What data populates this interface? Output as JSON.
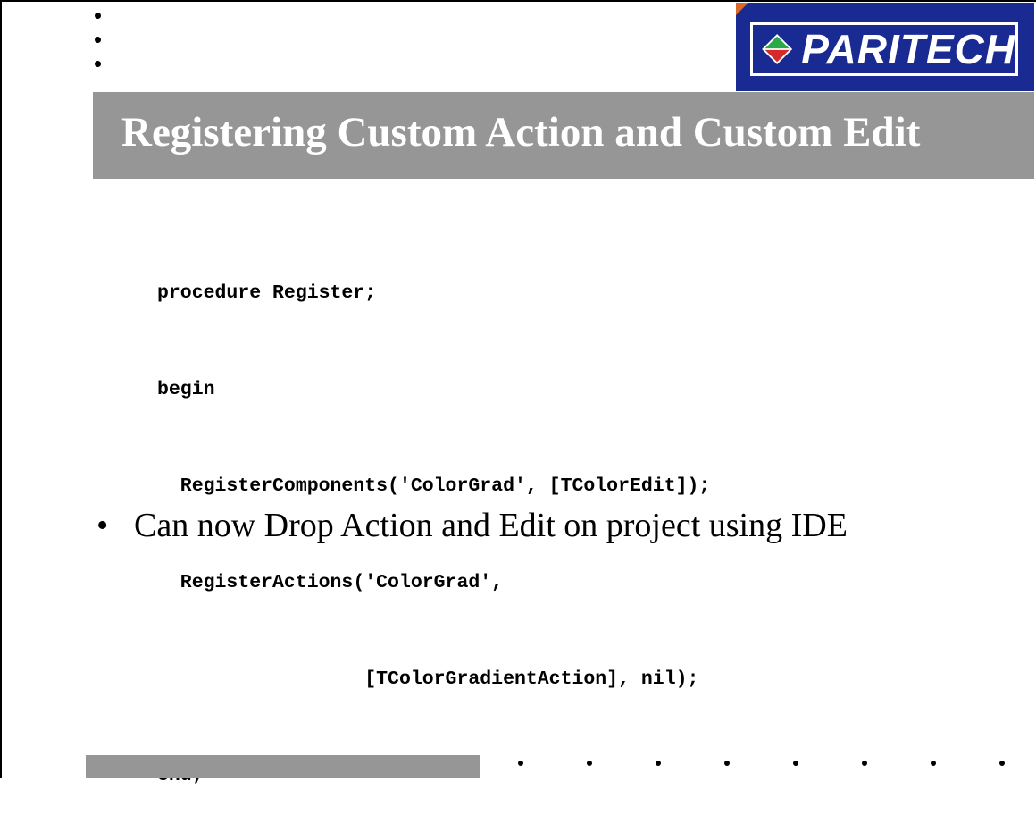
{
  "slide": {
    "title": "Registering Custom Action and Custom Edit",
    "logo_text": "PARITECH",
    "code_lines": [
      "procedure Register;",
      "begin",
      "  RegisterComponents('ColorGrad', [TColorEdit]);",
      "  RegisterActions('ColorGrad',",
      "                  [TColorGradientAction], nil);",
      "end;"
    ],
    "bullet_marker": "•",
    "bullet_text": "Can now Drop Action and Edit on project using IDE"
  },
  "colors": {
    "title_bar": "#969696",
    "logo_background": "#1a2a93",
    "logo_accent_red": "#d42a2a",
    "logo_accent_green": "#2aa84a"
  }
}
